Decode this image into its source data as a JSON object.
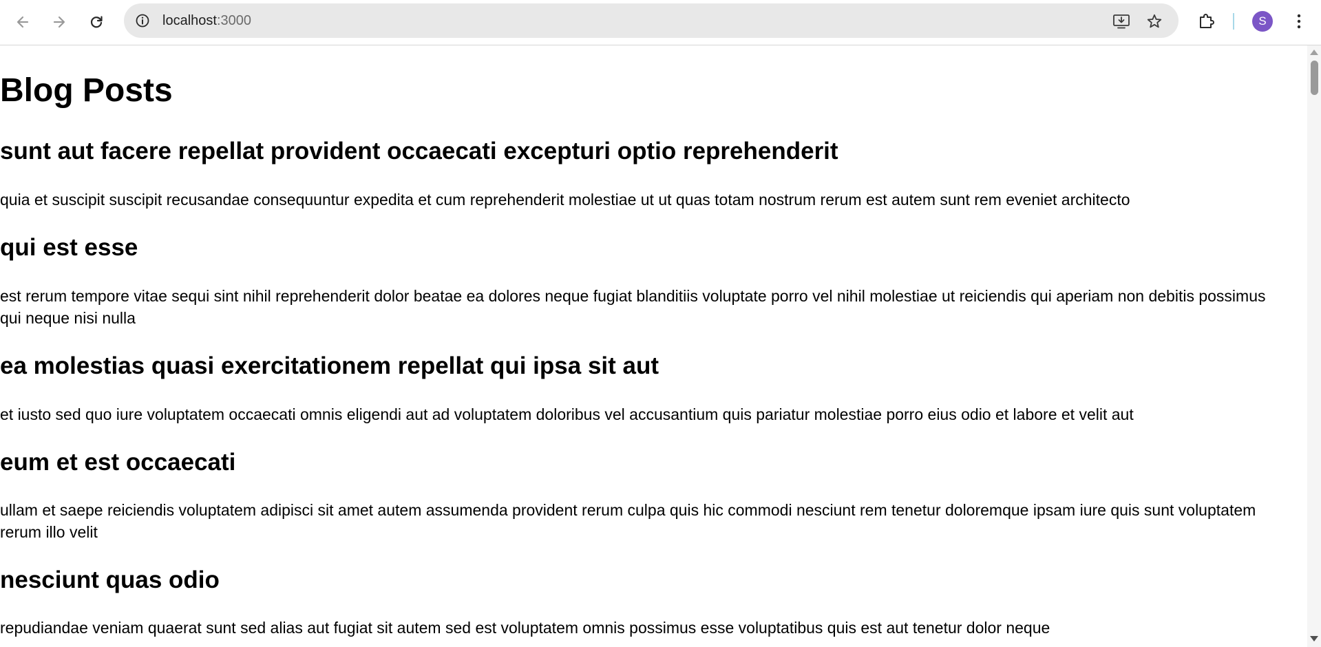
{
  "browser": {
    "address_bar": {
      "host": "localhost",
      "port": ":3000"
    },
    "profile_initial": "S",
    "icons": {
      "back": "arrow-left-icon",
      "forward": "arrow-right-icon",
      "reload": "reload-icon",
      "site_info": "info-icon",
      "install": "install-app-icon",
      "bookmark": "star-icon",
      "extensions": "puzzle-icon",
      "menu": "kebab-menu-icon"
    },
    "colors": {
      "avatar": "#7b56c6",
      "omnibox": "#e8e8e8"
    }
  },
  "page": {
    "title": "Blog Posts",
    "posts": [
      {
        "title": "sunt aut facere repellat provident occaecati excepturi optio reprehenderit",
        "body": "quia et suscipit suscipit recusandae consequuntur expedita et cum reprehenderit molestiae ut ut quas totam nostrum rerum est autem sunt rem eveniet architecto"
      },
      {
        "title": "qui est esse",
        "body": "est rerum tempore vitae sequi sint nihil reprehenderit dolor beatae ea dolores neque fugiat blanditiis voluptate porro vel nihil molestiae ut reiciendis qui aperiam non debitis possimus qui neque nisi nulla"
      },
      {
        "title": "ea molestias quasi exercitationem repellat qui ipsa sit aut",
        "body": "et iusto sed quo iure voluptatem occaecati omnis eligendi aut ad voluptatem doloribus vel accusantium quis pariatur molestiae porro eius odio et labore et velit aut"
      },
      {
        "title": "eum et est occaecati",
        "body": "ullam et saepe reiciendis voluptatem adipisci sit amet autem assumenda provident rerum culpa quis hic commodi nesciunt rem tenetur doloremque ipsam iure quis sunt voluptatem rerum illo velit"
      },
      {
        "title": "nesciunt quas odio",
        "body": "repudiandae veniam quaerat sunt sed alias aut fugiat sit autem sed est voluptatem omnis possimus esse voluptatibus quis est aut tenetur dolor neque"
      }
    ]
  }
}
